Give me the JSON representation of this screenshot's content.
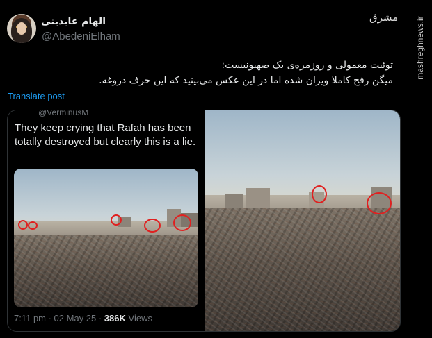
{
  "user": {
    "display_name": "الهام عابدینی",
    "handle": "@AbedeniElham"
  },
  "tweet": {
    "lines": [
      "توئیت معمولی و روزمره‌ی یک صهیونیست:",
      "میگن رفح کاملا ویران شده اما در این عکس می‌بینید که این حرف دروغه."
    ],
    "translate_label": "Translate post"
  },
  "quoted": {
    "handle": "@VerminusM",
    "text": "They keep crying that Rafah has been totally destroyed but clearly this is a lie.",
    "time": "7:11 pm · 02 May 25 · ",
    "views_count": "386K",
    "views_label": " Views"
  },
  "watermark": {
    "logo": "مشرق",
    "site": "mashreghnews.ir"
  },
  "colors": {
    "link": "#1d9bf0",
    "highlight_circle": "#e02020"
  }
}
